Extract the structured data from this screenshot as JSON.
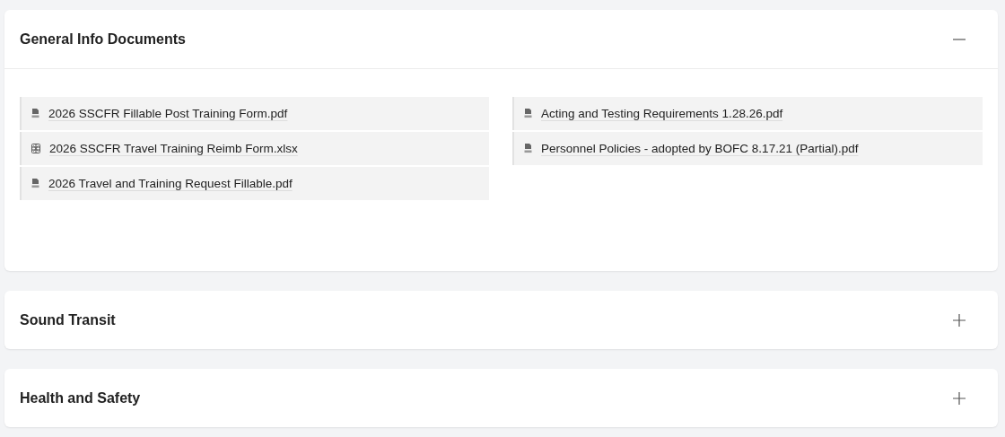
{
  "sections": [
    {
      "title": "General Info Documents",
      "expanded": true,
      "columns": [
        [
          {
            "name": "2026 SSCFR Fillable Post Training Form.pdf",
            "kind": "pdf"
          },
          {
            "name": "2026 SSCFR Travel Training Reimb Form.xlsx",
            "kind": "xlsx"
          },
          {
            "name": "2026 Travel and Training Request Fillable.pdf",
            "kind": "pdf"
          }
        ],
        [
          {
            "name": "Acting and Testing Requirements 1.28.26.pdf",
            "kind": "pdf"
          },
          {
            "name": "Personnel Policies - adopted by BOFC 8.17.21 (Partial).pdf",
            "kind": "pdf"
          }
        ]
      ]
    },
    {
      "title": "Sound Transit",
      "expanded": false
    },
    {
      "title": "Health and Safety",
      "expanded": false
    }
  ]
}
